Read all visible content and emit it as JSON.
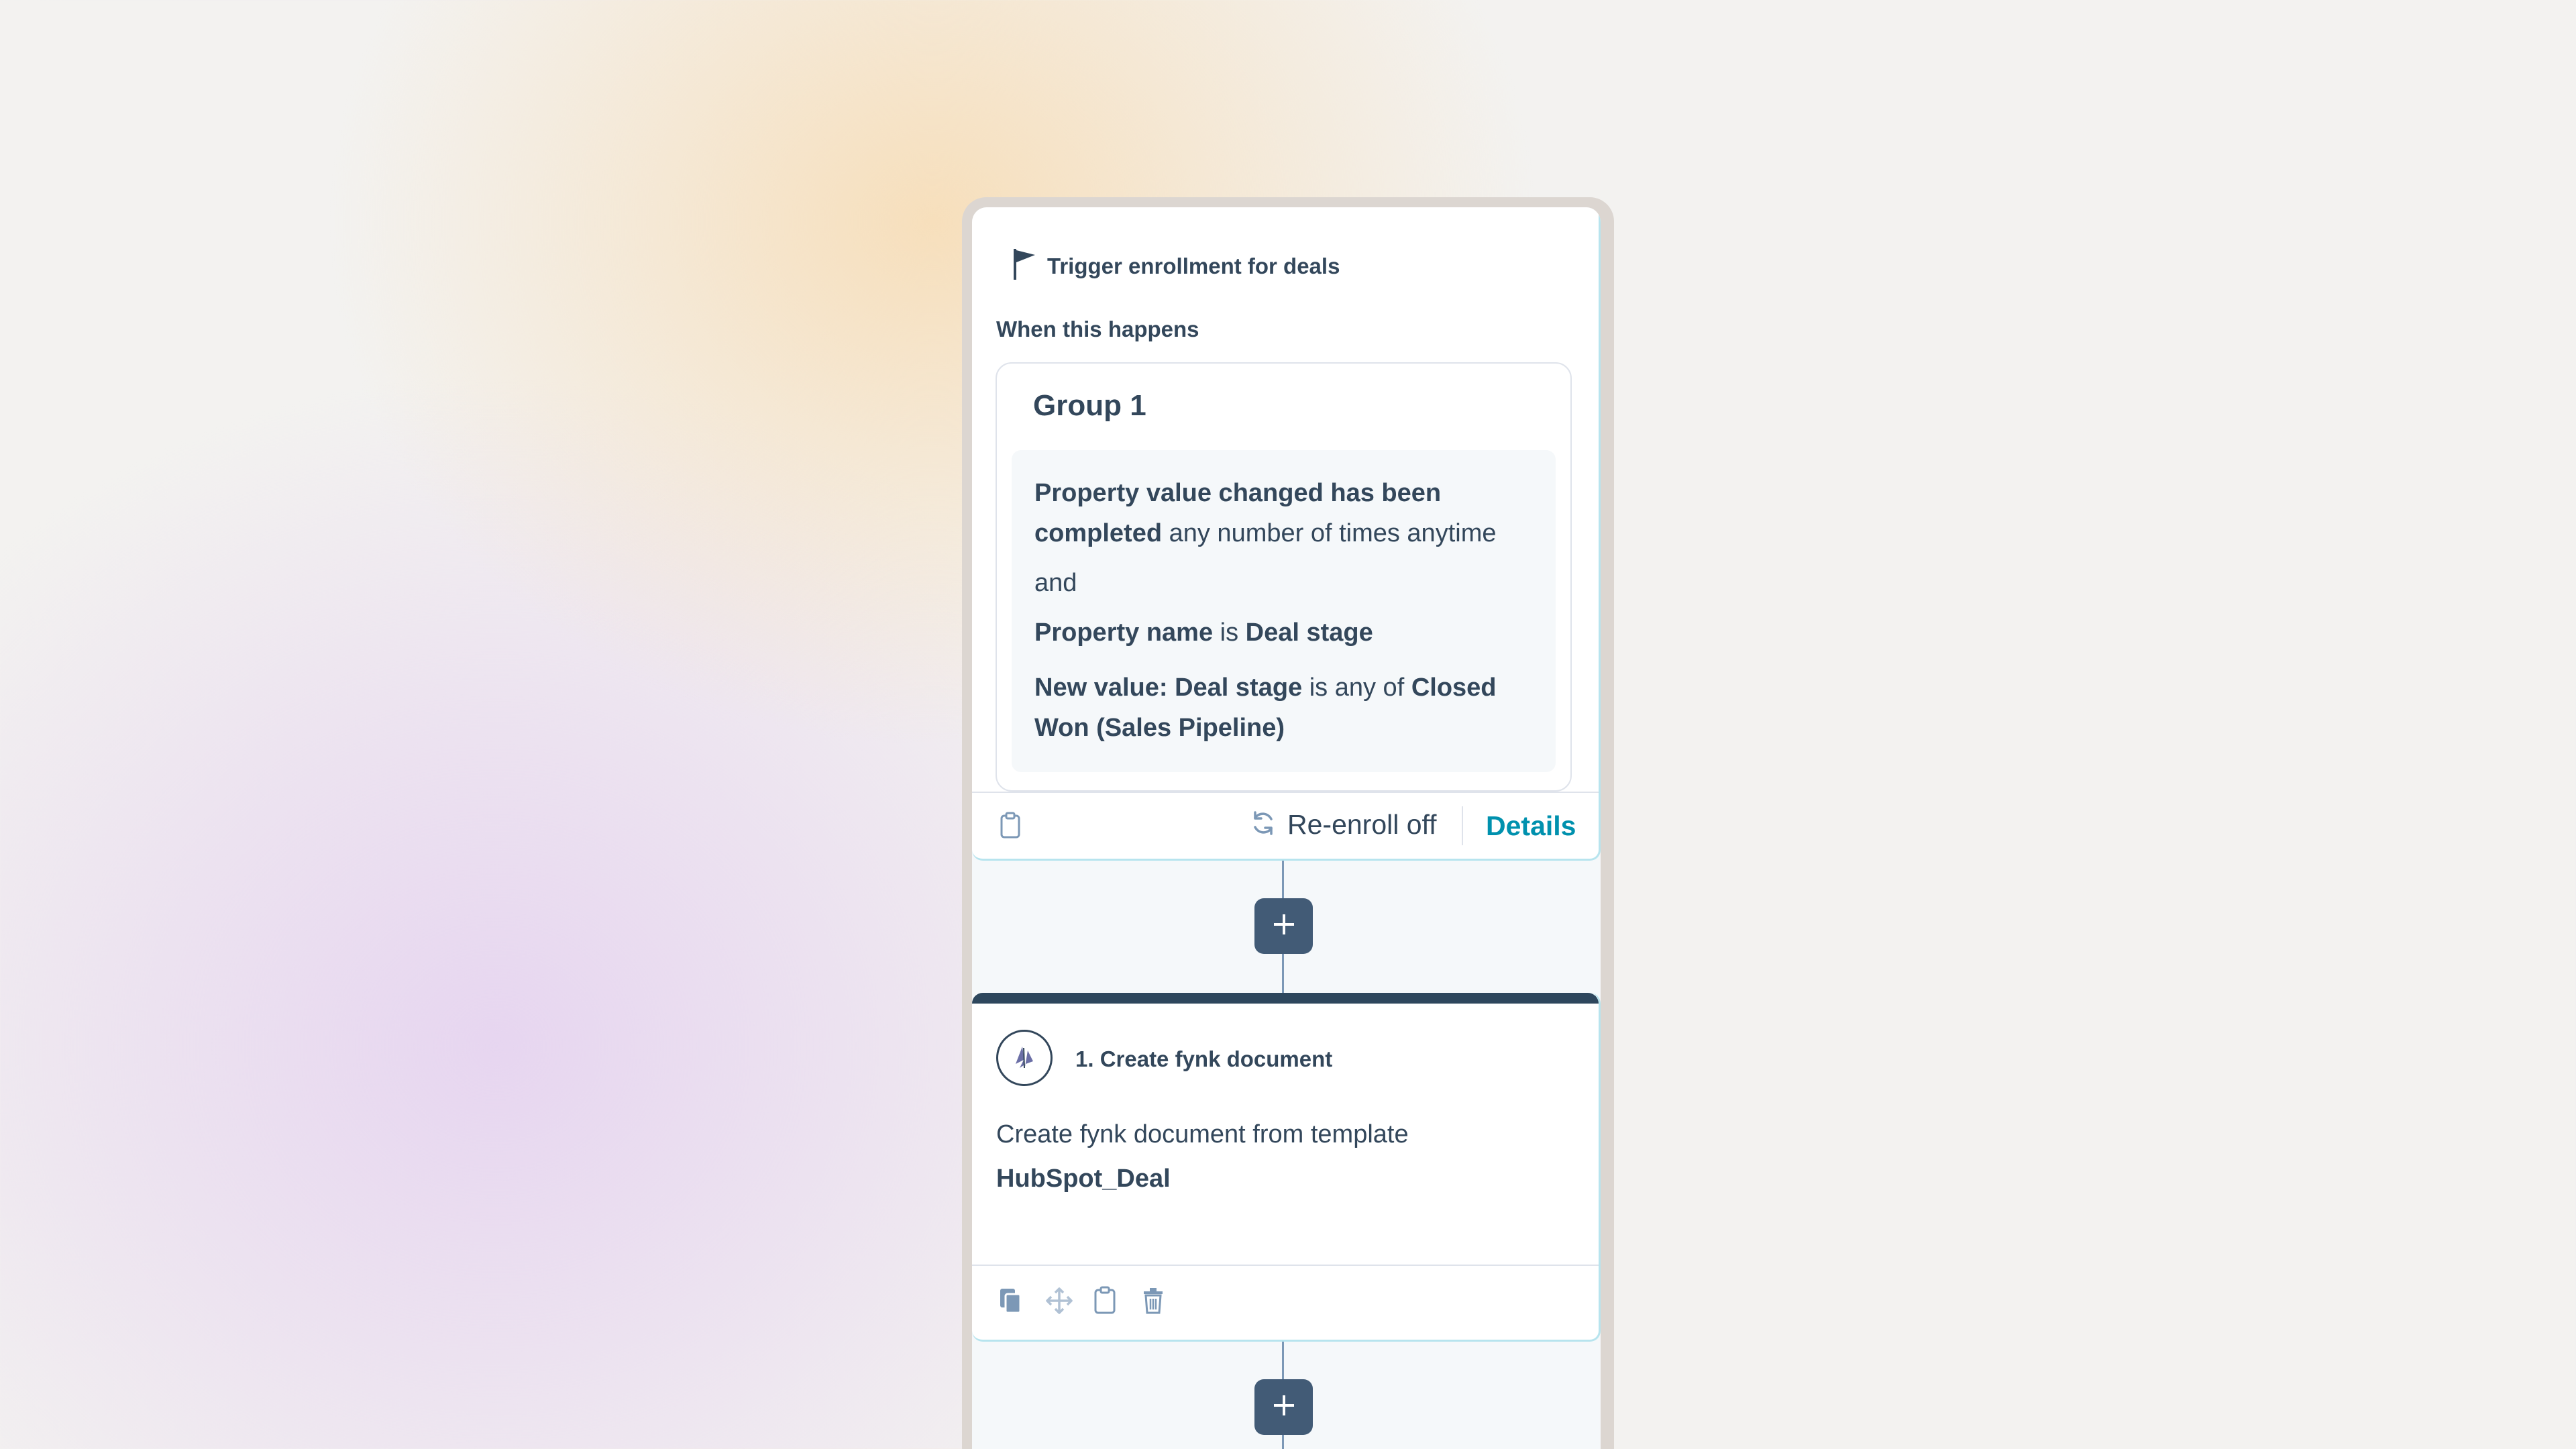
{
  "colors": {
    "text": "#33475b",
    "link": "#0091ae",
    "add_button": "#425b76",
    "card_accent": "#b7e4ee",
    "action_topbar": "#2e475d",
    "filter_bg": "#f5f8fa"
  },
  "trigger": {
    "title": "Trigger enrollment for deals",
    "when_label": "When this happens",
    "group_title": "Group 1",
    "filter_1": {
      "bold": "Property value changed has been completed",
      "rest": " any number of times anytime"
    },
    "conjunction": "and",
    "filter_2": {
      "part1": "Property name",
      "part2": " is ",
      "part3": "Deal stage"
    },
    "filter_3": {
      "part1": "New value: Deal stage",
      "part2": " is any of ",
      "part3": "Closed Won (Sales Pipeline)"
    },
    "reenroll_label": "Re-enroll off",
    "details_label": "Details",
    "icons": [
      "flag-icon",
      "clipboard-icon",
      "refresh-icon"
    ]
  },
  "action": {
    "title": "1. Create fynk document",
    "description": "Create fynk document from template",
    "template_name": "HubSpot_Deal",
    "icons": [
      "fynk-logo-icon",
      "copy-icon",
      "move-icon",
      "clipboard-icon",
      "trash-icon"
    ]
  },
  "add_buttons": [
    {
      "icon": "plus-icon"
    },
    {
      "icon": "plus-icon"
    }
  ]
}
